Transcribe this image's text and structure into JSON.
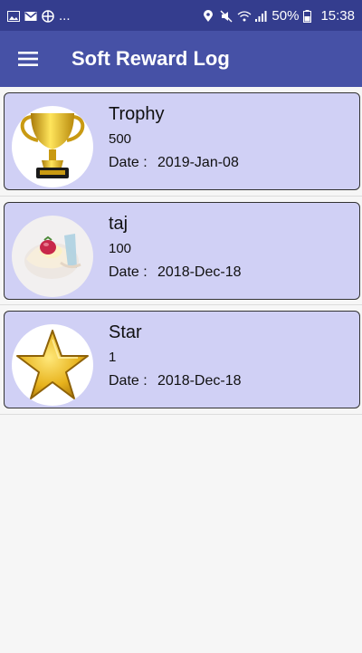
{
  "status_bar": {
    "left_extra": "...",
    "battery": "50%",
    "time": "15:38"
  },
  "app_bar": {
    "title": "Soft Reward Log"
  },
  "date_label": "Date :",
  "rewards": [
    {
      "name": "Trophy",
      "points": "500",
      "date": "2019-Jan-08",
      "icon": "trophy-icon"
    },
    {
      "name": "taj",
      "points": "100",
      "date": "2018-Dec-18",
      "icon": "dessert-icon"
    },
    {
      "name": "Star",
      "points": "1",
      "date": "2018-Dec-18",
      "icon": "star-icon"
    }
  ],
  "colors": {
    "status_bar": "#343d8e",
    "app_bar": "#4651a6",
    "card_background": "#d0d0f5"
  }
}
